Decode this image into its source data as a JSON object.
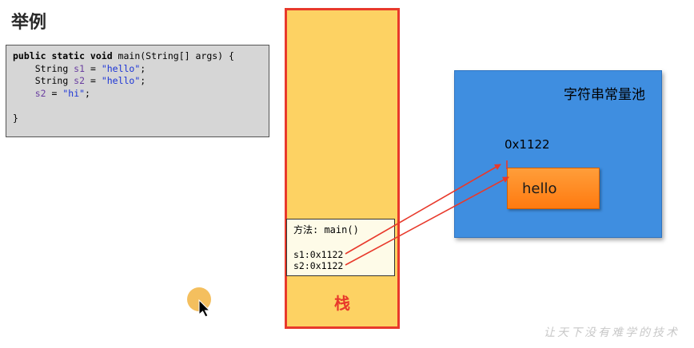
{
  "slide": {
    "title": "举例",
    "watermark": "让天下没有难学的技术"
  },
  "code": {
    "line1": {
      "kw": "public static void",
      "rest": " main(String[] args) {"
    },
    "line2": {
      "indent": "    ",
      "type": "String ",
      "var": "s1",
      "eq": " = ",
      "str": "\"hello\"",
      "end": ";"
    },
    "line3": {
      "indent": "    ",
      "type": "String ",
      "var": "s2",
      "eq": " = ",
      "str": "\"hello\"",
      "end": ";"
    },
    "line4": {
      "indent": "    ",
      "var": "s2",
      "eq": " = ",
      "str": "\"hi\"",
      "end": ";"
    },
    "line5": "}"
  },
  "stack": {
    "label": "栈",
    "frame_title": "方法: main()",
    "vars": [
      "s1:0x1122",
      "s2:0x1122"
    ]
  },
  "pool": {
    "title": "字符串常量池",
    "address": "0x1122",
    "value": "hello"
  },
  "colors": {
    "arrow": "#e8392b",
    "stack_fill": "#fdd263",
    "pool_fill": "#3f8ee0",
    "hello_fill": "#ff8a20"
  }
}
